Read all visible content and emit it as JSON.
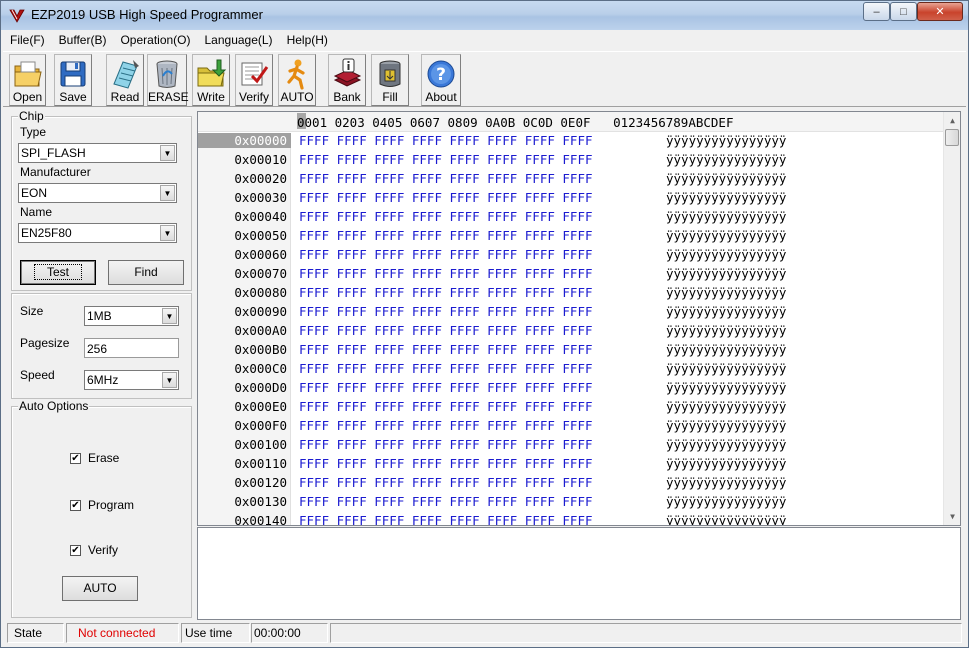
{
  "window": {
    "title": "EZP2019 USB High Speed Programmer"
  },
  "window_buttons": {
    "minimize": "–",
    "maximize": "□",
    "close": "✕"
  },
  "menu": [
    "File(F)",
    "Buffer(B)",
    "Operation(O)",
    "Language(L)",
    "Help(H)"
  ],
  "toolbar": {
    "open": "Open",
    "save": "Save",
    "read": "Read",
    "erase": "ERASE",
    "write": "Write",
    "verify": "Verify",
    "auto": "AUTO",
    "bank": "Bank",
    "fill": "Fill",
    "about": "About"
  },
  "chip": {
    "group_title": "Chip",
    "type_label": "Type",
    "type_value": "SPI_FLASH",
    "manufacturer_label": "Manufacturer",
    "manufacturer_value": "EON",
    "name_label": "Name",
    "name_value": "EN25F80",
    "test_button": "Test",
    "find_button": "Find"
  },
  "settings": {
    "size_label": "Size",
    "size_value": "1MB",
    "pagesize_label": "Pagesize",
    "pagesize_value": "256",
    "speed_label": "Speed",
    "speed_value": "6MHz"
  },
  "auto_options": {
    "group_title": "Auto Options",
    "erase_label": "Erase",
    "erase_checked": true,
    "program_label": "Program",
    "program_checked": true,
    "verify_label": "Verify",
    "verify_checked": true,
    "auto_button": "AUTO"
  },
  "hex": {
    "header": "0001 0203 0405 0607 0809 0A0B 0C0D 0E0F   0123456789ABCDEF",
    "rows": [
      {
        "addr": "0x00000",
        "bytes": "FFFF FFFF FFFF FFFF FFFF FFFF FFFF FFFF",
        "ascii": "ÿÿÿÿÿÿÿÿÿÿÿÿÿÿÿÿ"
      },
      {
        "addr": "0x00010",
        "bytes": "FFFF FFFF FFFF FFFF FFFF FFFF FFFF FFFF",
        "ascii": "ÿÿÿÿÿÿÿÿÿÿÿÿÿÿÿÿ"
      },
      {
        "addr": "0x00020",
        "bytes": "FFFF FFFF FFFF FFFF FFFF FFFF FFFF FFFF",
        "ascii": "ÿÿÿÿÿÿÿÿÿÿÿÿÿÿÿÿ"
      },
      {
        "addr": "0x00030",
        "bytes": "FFFF FFFF FFFF FFFF FFFF FFFF FFFF FFFF",
        "ascii": "ÿÿÿÿÿÿÿÿÿÿÿÿÿÿÿÿ"
      },
      {
        "addr": "0x00040",
        "bytes": "FFFF FFFF FFFF FFFF FFFF FFFF FFFF FFFF",
        "ascii": "ÿÿÿÿÿÿÿÿÿÿÿÿÿÿÿÿ"
      },
      {
        "addr": "0x00050",
        "bytes": "FFFF FFFF FFFF FFFF FFFF FFFF FFFF FFFF",
        "ascii": "ÿÿÿÿÿÿÿÿÿÿÿÿÿÿÿÿ"
      },
      {
        "addr": "0x00060",
        "bytes": "FFFF FFFF FFFF FFFF FFFF FFFF FFFF FFFF",
        "ascii": "ÿÿÿÿÿÿÿÿÿÿÿÿÿÿÿÿ"
      },
      {
        "addr": "0x00070",
        "bytes": "FFFF FFFF FFFF FFFF FFFF FFFF FFFF FFFF",
        "ascii": "ÿÿÿÿÿÿÿÿÿÿÿÿÿÿÿÿ"
      },
      {
        "addr": "0x00080",
        "bytes": "FFFF FFFF FFFF FFFF FFFF FFFF FFFF FFFF",
        "ascii": "ÿÿÿÿÿÿÿÿÿÿÿÿÿÿÿÿ"
      },
      {
        "addr": "0x00090",
        "bytes": "FFFF FFFF FFFF FFFF FFFF FFFF FFFF FFFF",
        "ascii": "ÿÿÿÿÿÿÿÿÿÿÿÿÿÿÿÿ"
      },
      {
        "addr": "0x000A0",
        "bytes": "FFFF FFFF FFFF FFFF FFFF FFFF FFFF FFFF",
        "ascii": "ÿÿÿÿÿÿÿÿÿÿÿÿÿÿÿÿ"
      },
      {
        "addr": "0x000B0",
        "bytes": "FFFF FFFF FFFF FFFF FFFF FFFF FFFF FFFF",
        "ascii": "ÿÿÿÿÿÿÿÿÿÿÿÿÿÿÿÿ"
      },
      {
        "addr": "0x000C0",
        "bytes": "FFFF FFFF FFFF FFFF FFFF FFFF FFFF FFFF",
        "ascii": "ÿÿÿÿÿÿÿÿÿÿÿÿÿÿÿÿ"
      },
      {
        "addr": "0x000D0",
        "bytes": "FFFF FFFF FFFF FFFF FFFF FFFF FFFF FFFF",
        "ascii": "ÿÿÿÿÿÿÿÿÿÿÿÿÿÿÿÿ"
      },
      {
        "addr": "0x000E0",
        "bytes": "FFFF FFFF FFFF FFFF FFFF FFFF FFFF FFFF",
        "ascii": "ÿÿÿÿÿÿÿÿÿÿÿÿÿÿÿÿ"
      },
      {
        "addr": "0x000F0",
        "bytes": "FFFF FFFF FFFF FFFF FFFF FFFF FFFF FFFF",
        "ascii": "ÿÿÿÿÿÿÿÿÿÿÿÿÿÿÿÿ"
      },
      {
        "addr": "0x00100",
        "bytes": "FFFF FFFF FFFF FFFF FFFF FFFF FFFF FFFF",
        "ascii": "ÿÿÿÿÿÿÿÿÿÿÿÿÿÿÿÿ"
      },
      {
        "addr": "0x00110",
        "bytes": "FFFF FFFF FFFF FFFF FFFF FFFF FFFF FFFF",
        "ascii": "ÿÿÿÿÿÿÿÿÿÿÿÿÿÿÿÿ"
      },
      {
        "addr": "0x00120",
        "bytes": "FFFF FFFF FFFF FFFF FFFF FFFF FFFF FFFF",
        "ascii": "ÿÿÿÿÿÿÿÿÿÿÿÿÿÿÿÿ"
      },
      {
        "addr": "0x00130",
        "bytes": "FFFF FFFF FFFF FFFF FFFF FFFF FFFF FFFF",
        "ascii": "ÿÿÿÿÿÿÿÿÿÿÿÿÿÿÿÿ"
      },
      {
        "addr": "0x00140",
        "bytes": "FFFF FFFF FFFF FFFF FFFF FFFF FFFF FFFF",
        "ascii": "ÿÿÿÿÿÿÿÿÿÿÿÿÿÿÿÿ"
      }
    ]
  },
  "status": {
    "state_label": "State",
    "state_value": "Not connected",
    "state_color": "#e00000",
    "usetime_label": "Use time",
    "usetime_value": "00:00:00"
  }
}
